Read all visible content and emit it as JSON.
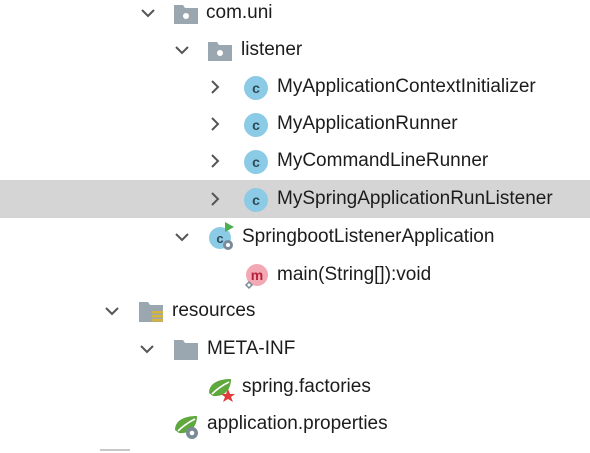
{
  "tree": {
    "items": [
      {
        "label": "com.uni",
        "icon": "package-folder-icon",
        "chevron": "expanded"
      },
      {
        "label": "listener",
        "icon": "package-folder-icon",
        "chevron": "expanded"
      },
      {
        "label": "MyApplicationContextInitializer",
        "icon": "class-icon",
        "chevron": "collapsed"
      },
      {
        "label": "MyApplicationRunner",
        "icon": "class-icon",
        "chevron": "collapsed"
      },
      {
        "label": "MyCommandLineRunner",
        "icon": "class-icon",
        "chevron": "collapsed"
      },
      {
        "label": "MySpringApplicationRunListener",
        "icon": "class-icon",
        "chevron": "collapsed",
        "selected": true
      },
      {
        "label": "SpringbootListenerApplication",
        "icon": "spring-boot-app-class-icon",
        "chevron": "expanded"
      },
      {
        "label": "main(String[]):void",
        "icon": "method-icon",
        "chevron": "none"
      },
      {
        "label": "resources",
        "icon": "resources-folder-icon",
        "chevron": "expanded"
      },
      {
        "label": "META-INF",
        "icon": "folder-icon",
        "chevron": "expanded"
      },
      {
        "label": "spring.factories",
        "icon": "spring-factories-icon",
        "chevron": "none"
      },
      {
        "label": "application.properties",
        "icon": "spring-properties-icon",
        "chevron": "none"
      }
    ]
  },
  "colors": {
    "selection": "#d5d5d5",
    "class_icon": "#8ccbe6",
    "class_letter": "#2b4a5a",
    "method_icon": "#f3a9b3",
    "method_letter": "#b9203c",
    "folder": "#9aa7b0",
    "spring_green": "#5ea83e",
    "run_arrow": "#4caf50",
    "gear": "#7a8a98",
    "star_red": "#e03a3a",
    "resources_stripes": "#d6b53a"
  }
}
